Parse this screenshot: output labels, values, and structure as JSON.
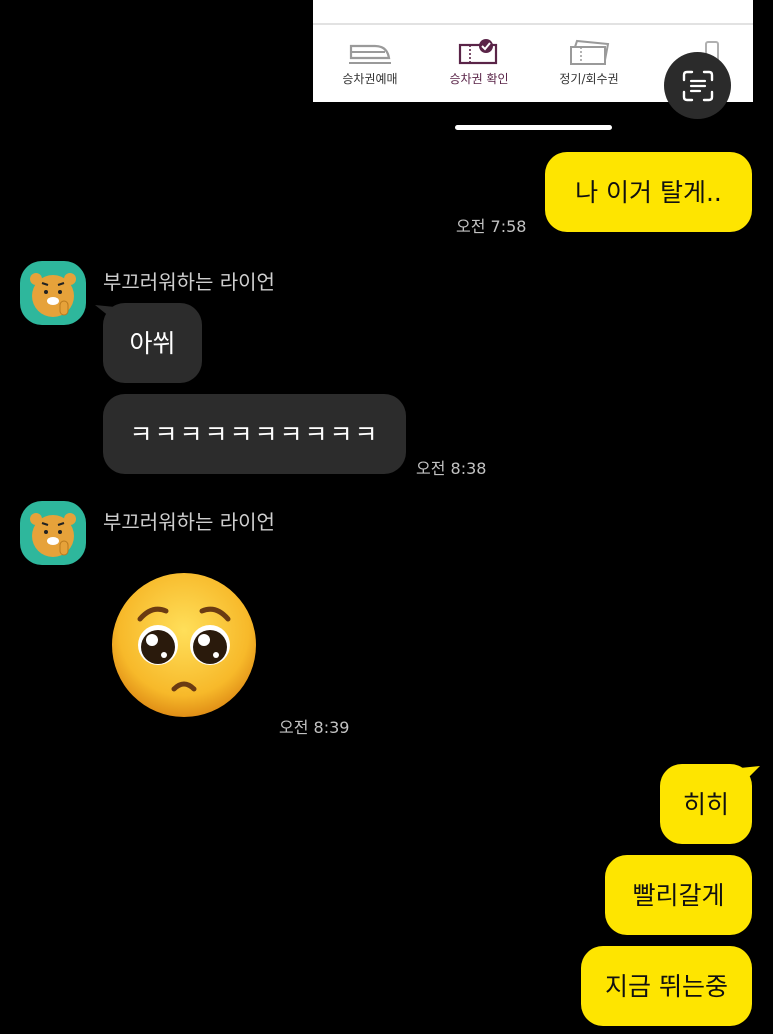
{
  "preview": {
    "tabs": [
      {
        "label": "승차권예매",
        "icon": "train-icon"
      },
      {
        "label": "승차권 확인",
        "icon": "ticket-check-icon"
      },
      {
        "label": "정기/회수권",
        "icon": "season-ticket-icon"
      },
      {
        "label": "",
        "icon": "wallet-icon"
      }
    ],
    "scan_icon": "text-scan-icon"
  },
  "colors": {
    "my_bubble": "#fee500",
    "their_bubble": "#2c2c2c",
    "background": "#000000",
    "avatar_bg": "#2eb79c"
  },
  "messages": {
    "m1": {
      "text": "나 이거 탈게..",
      "time": "오전 7:58"
    },
    "g1": {
      "sender": "부끄러워하는 라이언",
      "bubble1": "아쒸",
      "bubble2": "ㅋㅋㅋㅋㅋㅋㅋㅋㅋㅋ",
      "time": "오전 8:38"
    },
    "g2": {
      "sender": "부끄러워하는 라이언",
      "emoji": "pleading-face-emoji",
      "time": "오전 8:39"
    },
    "m2": {
      "bubble1": "히히",
      "bubble2": "빨리갈게",
      "bubble3": "지금 뛰는중"
    }
  }
}
